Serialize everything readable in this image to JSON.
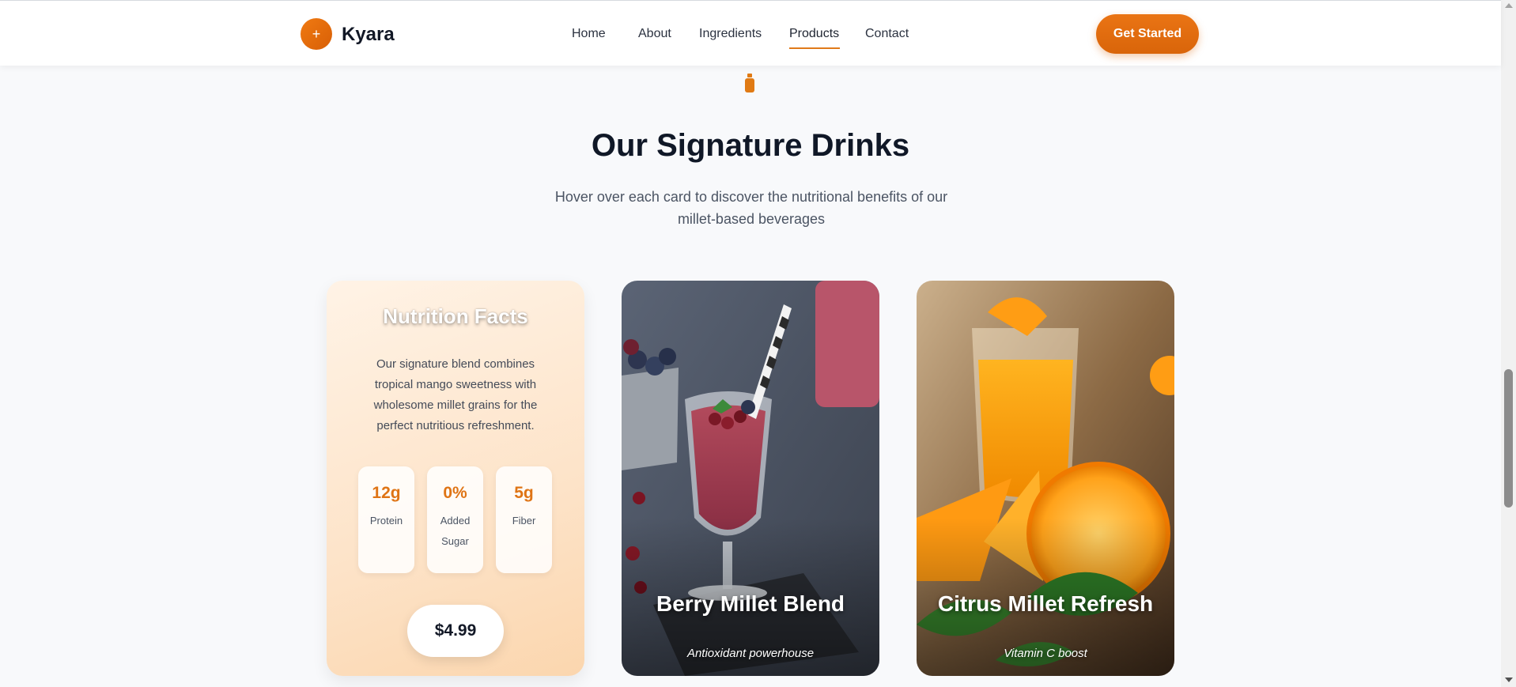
{
  "header": {
    "logo_symbol": "+",
    "brand": "Kyara",
    "nav": [
      {
        "label": "Home"
      },
      {
        "label": "About"
      },
      {
        "label": "Ingredients"
      },
      {
        "label": "Products",
        "active": true
      },
      {
        "label": "Contact"
      }
    ],
    "cta_label": "Get Started"
  },
  "section": {
    "icon": "bottle-icon",
    "title": "Our Signature Drinks",
    "subtitle": "Hover over each card to discover the nutritional benefits of our millet-based beverages"
  },
  "cards": {
    "nutrition": {
      "title": "Nutrition Facts",
      "description": "Our signature blend combines tropical mango sweetness with wholesome millet grains for the perfect nutritious refreshment.",
      "stats": [
        {
          "value": "12g",
          "label": "Protein"
        },
        {
          "value": "0%",
          "label": "Added Sugar"
        },
        {
          "value": "5g",
          "label": "Fiber"
        }
      ],
      "price": "$4.99"
    },
    "berry": {
      "name": "Berry Millet Blend",
      "tagline": "Antioxidant powerhouse"
    },
    "citrus": {
      "name": "Citrus Millet Refresh",
      "tagline": "Vitamin C boost"
    }
  },
  "colors": {
    "accent": "#e07a1a",
    "heading": "#101827",
    "text": "#4b5463",
    "background": "#f8f9fb"
  }
}
